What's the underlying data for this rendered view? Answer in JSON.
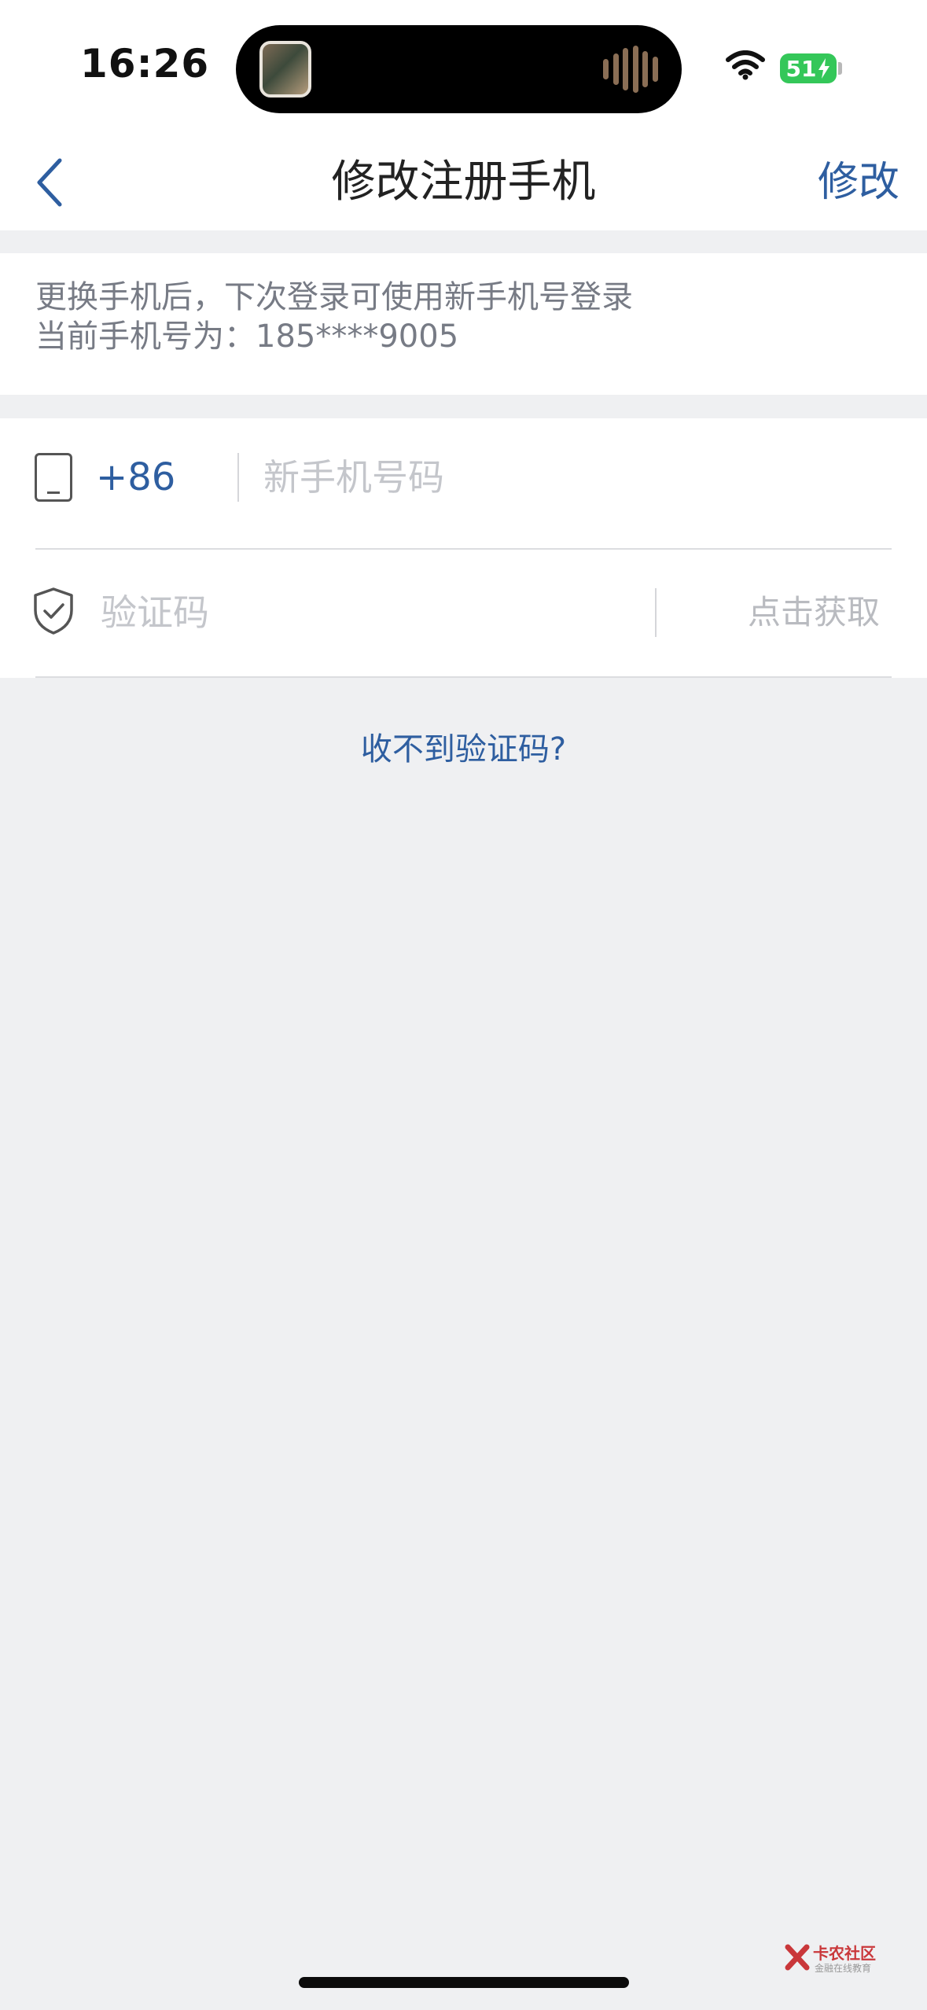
{
  "status_bar": {
    "time": "16:26",
    "battery": "51"
  },
  "nav": {
    "title": "修改注册手机",
    "action": "修改"
  },
  "info": {
    "line1": "更换手机后，下次登录可使用新手机号登录",
    "line2": "当前手机号为：185****9005"
  },
  "form": {
    "country_code": "+86",
    "phone_placeholder": "新手机号码",
    "code_placeholder": "验证码",
    "get_code": "点击获取"
  },
  "links": {
    "no_code": "收不到验证码?"
  },
  "watermark": {
    "name": "卡农社区",
    "sub": "金融在线教育"
  },
  "colors": {
    "accent": "#2e5ea0",
    "background": "#eff0f2",
    "battery": "#34c759"
  }
}
